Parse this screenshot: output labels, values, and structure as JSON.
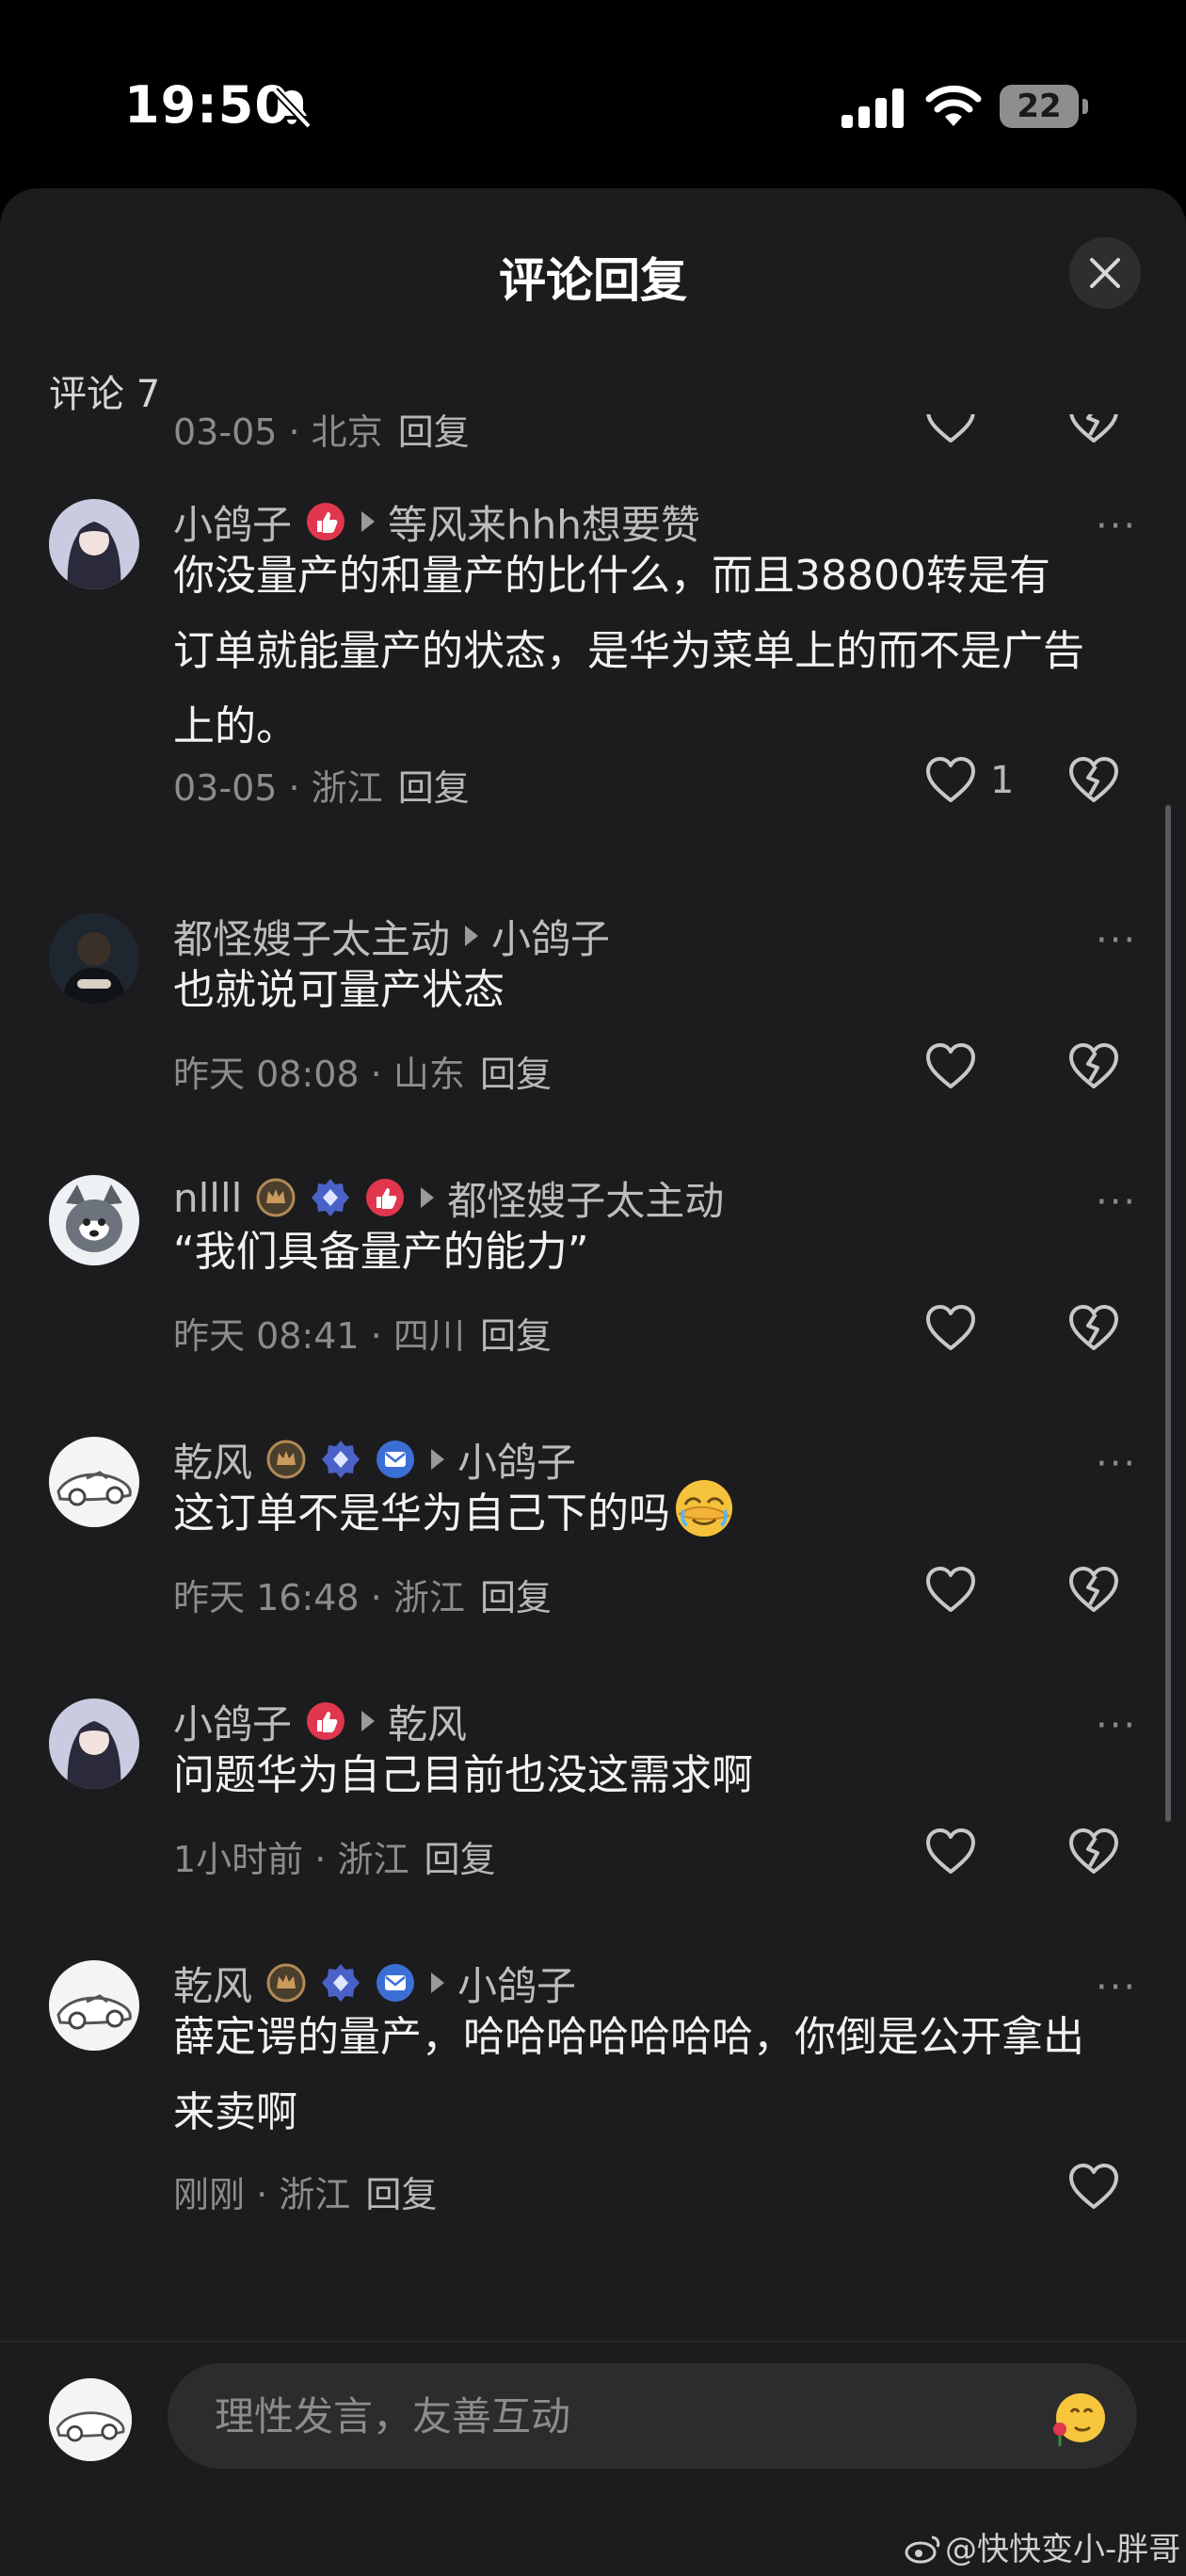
{
  "status_bar": {
    "time": "19:50",
    "battery": "22"
  },
  "sheet": {
    "title": "评论回复",
    "count_label": "评论 7"
  },
  "partial_meta": {
    "date": "03-05",
    "location": "北京",
    "reply": "回复"
  },
  "comments": [
    {
      "name": "小鸽子",
      "badges": [
        "thumb-badge-icon"
      ],
      "reply_to": "等风来hhh想要赞",
      "lines": [
        "你没量产的和量产的比什么，而且38800转是有",
        "订单就能量产的状态，是华为菜单上的而不是广告",
        "上的。"
      ],
      "time": "03-05",
      "location": "浙江",
      "reply": "回复",
      "likes": "1"
    },
    {
      "name": "都怪嫂子太主动",
      "badges": [],
      "reply_to": "小鸽子",
      "lines": [
        "也就说可量产状态"
      ],
      "time": "昨天 08:08",
      "location": "山东",
      "reply": "回复",
      "likes": ""
    },
    {
      "name": "nllll",
      "badges": [
        "crown-badge-icon",
        "diamond-badge-icon",
        "thumb-badge-icon"
      ],
      "reply_to": "都怪嫂子太主动",
      "lines": [
        "“我们具备量产的能力”"
      ],
      "time": "昨天 08:41",
      "location": "四川",
      "reply": "回复",
      "likes": ""
    },
    {
      "name": "乾风",
      "badges": [
        "crown-badge-icon",
        "diamond-badge-icon",
        "mail-badge-icon"
      ],
      "reply_to": "小鸽子",
      "lines": [
        "这订单不是华为自己下的吗"
      ],
      "time": "昨天 16:48",
      "location": "浙江",
      "reply": "回复",
      "likes": ""
    },
    {
      "name": "小鸽子",
      "badges": [
        "thumb-badge-icon"
      ],
      "reply_to": "乾风",
      "lines": [
        "问题华为自己目前也没这需求啊"
      ],
      "time": "1小时前",
      "location": "浙江",
      "reply": "回复",
      "likes": ""
    },
    {
      "name": "乾风",
      "badges": [
        "crown-badge-icon",
        "diamond-badge-icon",
        "mail-badge-icon"
      ],
      "reply_to": "小鸽子",
      "lines": [
        "薛定谔的量产，哈哈哈哈哈哈哈，你倒是公开拿出",
        "来卖啊"
      ],
      "time": "刚刚",
      "location": "浙江",
      "reply": "回复",
      "likes": ""
    }
  ],
  "input": {
    "placeholder": "理性发言，友善互动"
  },
  "watermark": "@快快变小-胖哥"
}
